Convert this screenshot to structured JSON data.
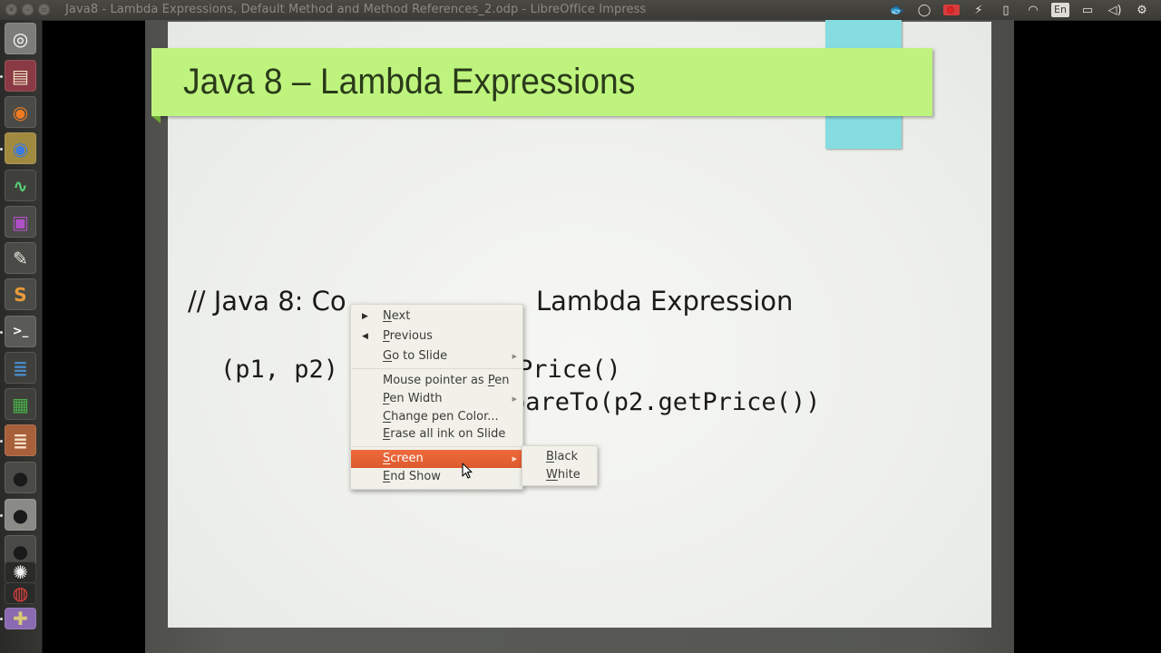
{
  "window": {
    "title": "Java8 - Lambda Expressions, Default Method and Method References_2.odp - LibreOffice Impress",
    "controls": [
      "close",
      "minimize",
      "maximize"
    ]
  },
  "tray": {
    "items": [
      {
        "name": "fish-icon",
        "glyph": "🐟"
      },
      {
        "name": "lightbulb-icon",
        "glyph": "💡"
      },
      {
        "name": "record-icon",
        "glyph": ""
      },
      {
        "name": "lightning-icon",
        "glyph": "⚡"
      },
      {
        "name": "app-indicator-icon",
        "glyph": "▯"
      },
      {
        "name": "wifi-icon",
        "glyph": "◠"
      },
      {
        "name": "keyboard-layout",
        "glyph": "En"
      },
      {
        "name": "battery-icon",
        "glyph": "▭"
      },
      {
        "name": "volume-icon",
        "glyph": "🔊"
      },
      {
        "name": "power-gear-icon",
        "glyph": "⚙"
      }
    ]
  },
  "launcher": {
    "items": [
      {
        "name": "ubuntu-dash",
        "glyph": "◎",
        "bg": "#7c7d79",
        "fg": "#ffffff"
      },
      {
        "name": "files",
        "glyph": "▤",
        "bg": "#8a3a45",
        "fg": "#f0e0c0"
      },
      {
        "name": "firefox",
        "glyph": "◉",
        "bg": "#4a4b47",
        "fg": "#f07a20"
      },
      {
        "name": "chrome",
        "glyph": "◉",
        "bg": "#a08a40",
        "fg": "#3a7ae0"
      },
      {
        "name": "system-monitor",
        "glyph": "∿",
        "bg": "#3f403c",
        "fg": "#5ad07a"
      },
      {
        "name": "media-player",
        "glyph": "▣",
        "bg": "#4a4b47",
        "fg": "#b050c8"
      },
      {
        "name": "text-editor",
        "glyph": "✎",
        "bg": "#4a4b47",
        "fg": "#e8e8e0"
      },
      {
        "name": "sublime-text",
        "glyph": "S",
        "bg": "#4a4b47",
        "fg": "#e89a3a"
      },
      {
        "name": "terminal",
        "glyph": ">_",
        "bg": "#5a5b57",
        "fg": "#ffffff"
      },
      {
        "name": "libreoffice-writer",
        "glyph": "≣",
        "bg": "#3f403c",
        "fg": "#4a8ac8"
      },
      {
        "name": "libreoffice-calc",
        "glyph": "▦",
        "bg": "#3f403c",
        "fg": "#48b048"
      },
      {
        "name": "libreoffice-impress",
        "glyph": "≣",
        "bg": "#a8603a",
        "fg": "#f8e0c8"
      },
      {
        "name": "webcam-1",
        "glyph": "●",
        "bg": "#4a4b47",
        "fg": "#1a1a1a"
      },
      {
        "name": "webcam-2",
        "glyph": "●",
        "bg": "#8a8b87",
        "fg": "#1a1a1a"
      },
      {
        "name": "webcam-3",
        "glyph": "●",
        "bg": "#4a4b47",
        "fg": "#1a1a1a"
      },
      {
        "name": "flower-app",
        "glyph": "✺",
        "bg": "#2a2b28",
        "fg": "#f0f0f0"
      },
      {
        "name": "colorful-app",
        "glyph": "◍",
        "bg": "#2a2b28",
        "fg": "#e84040"
      },
      {
        "name": "archive-manager",
        "glyph": "✚",
        "bg": "#8a6ab0",
        "fg": "#d8c878"
      }
    ]
  },
  "slide": {
    "title": "Java 8 – Lambda Expressions",
    "comment_left": "// Java 8: Co",
    "comment_right": "Lambda Expression",
    "code_line1_left": "(p1, p2)",
    "code_line1_right": "Price()",
    "code_line2_right": "pareTo(p2.getPrice())",
    "colors": {
      "banner": "#bef47e",
      "accent_block": "#86dde0"
    }
  },
  "context_menu": {
    "items": [
      {
        "label": "Next",
        "mnemonic": "N",
        "rest": "ext",
        "lead": "▶"
      },
      {
        "label": "Previous",
        "mnemonic": "P",
        "rest": "revious",
        "lead": "◀"
      },
      {
        "label": "Go to Slide",
        "mnemonic": "G",
        "rest": "o to Slide",
        "submenu": true
      },
      {
        "label": "Mouse pointer as Pen",
        "pre": "Mouse pointer as ",
        "mnemonic": "P",
        "rest": "en"
      },
      {
        "label": "Pen Width",
        "mnemonic": "P",
        "rest": "en Width",
        "submenu": true
      },
      {
        "label": "Change pen Color...",
        "mnemonic": "C",
        "rest": "hange pen Color..."
      },
      {
        "label": "Erase all ink on Slide",
        "mnemonic": "E",
        "rest": "rase all ink on Slide"
      },
      {
        "label": "Screen",
        "mnemonic": "S",
        "rest": "creen",
        "submenu": true,
        "active": true
      },
      {
        "label": "End Show",
        "mnemonic": "E",
        "rest": "nd Show"
      }
    ],
    "submenu_screen": [
      {
        "label": "Black",
        "mnemonic": "B",
        "rest": "lack"
      },
      {
        "label": "White",
        "mnemonic": "W",
        "rest": "hite"
      }
    ],
    "active_color": "#e5622f"
  }
}
